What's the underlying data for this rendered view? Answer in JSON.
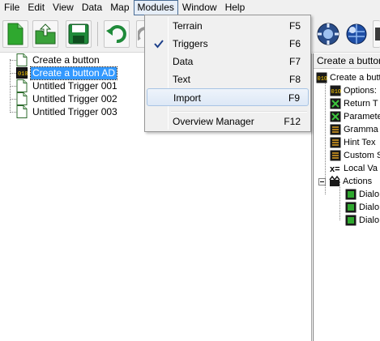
{
  "menubar": {
    "items": [
      "File",
      "Edit",
      "View",
      "Data",
      "Map",
      "Modules",
      "Window",
      "Help"
    ],
    "open_menu": "Modules"
  },
  "modules_menu": {
    "items": [
      {
        "label": "Terrain",
        "shortcut": "F5",
        "checked": false
      },
      {
        "label": "Triggers",
        "shortcut": "F6",
        "checked": true
      },
      {
        "label": "Data",
        "shortcut": "F7",
        "checked": false
      },
      {
        "label": "Text",
        "shortcut": "F8",
        "checked": false
      },
      {
        "label": "Import",
        "shortcut": "F9",
        "checked": false,
        "highlighted": true
      },
      {
        "label": "Overview Manager",
        "shortcut": "F12",
        "checked": false
      }
    ]
  },
  "toolbar": {
    "buttons": [
      "new-document-icon",
      "open-folder-icon",
      "save-icon",
      "undo-icon"
    ]
  },
  "trigger_tree": {
    "items": [
      {
        "label": "Create a button",
        "icon": "document-icon",
        "selected": false
      },
      {
        "label": "Create a button AD",
        "icon": "trigger-icon",
        "selected": true
      },
      {
        "label": "Untitled Trigger 001",
        "icon": "document-icon",
        "selected": false
      },
      {
        "label": "Untitled Trigger 002",
        "icon": "document-icon",
        "selected": false
      },
      {
        "label": "Untitled Trigger 003",
        "icon": "document-icon",
        "selected": false
      }
    ]
  },
  "right_panel": {
    "header": "Create a button .",
    "tree": [
      {
        "label": "Create a butt",
        "icon": "trigger-icon",
        "indent": 0
      },
      {
        "label": "Options:",
        "icon": "options-icon",
        "indent": 1
      },
      {
        "label": "Return T",
        "icon": "return-icon",
        "indent": 1
      },
      {
        "label": "Parameter",
        "icon": "parameter-icon",
        "indent": 1
      },
      {
        "label": "Gramma",
        "icon": "grammar-icon",
        "indent": 1
      },
      {
        "label": "Hint Tex",
        "icon": "hint-icon",
        "indent": 1
      },
      {
        "label": "Custom S",
        "icon": "custom-icon",
        "indent": 1
      },
      {
        "label": "Local Va",
        "icon": "local-var-icon",
        "indent": 1
      },
      {
        "label": "Actions",
        "icon": "actions-icon",
        "indent": 1,
        "expander": "-"
      },
      {
        "label": "Dialo",
        "icon": "dialog-icon",
        "indent": 2
      },
      {
        "label": "Dialo",
        "icon": "dialog-icon",
        "indent": 2
      },
      {
        "label": "Dialo",
        "icon": "dialog-icon",
        "indent": 2
      }
    ]
  },
  "colors": {
    "selection": "#3399ff",
    "menu_bg": "#f0f0f0",
    "highlight": "#dde8f6"
  }
}
